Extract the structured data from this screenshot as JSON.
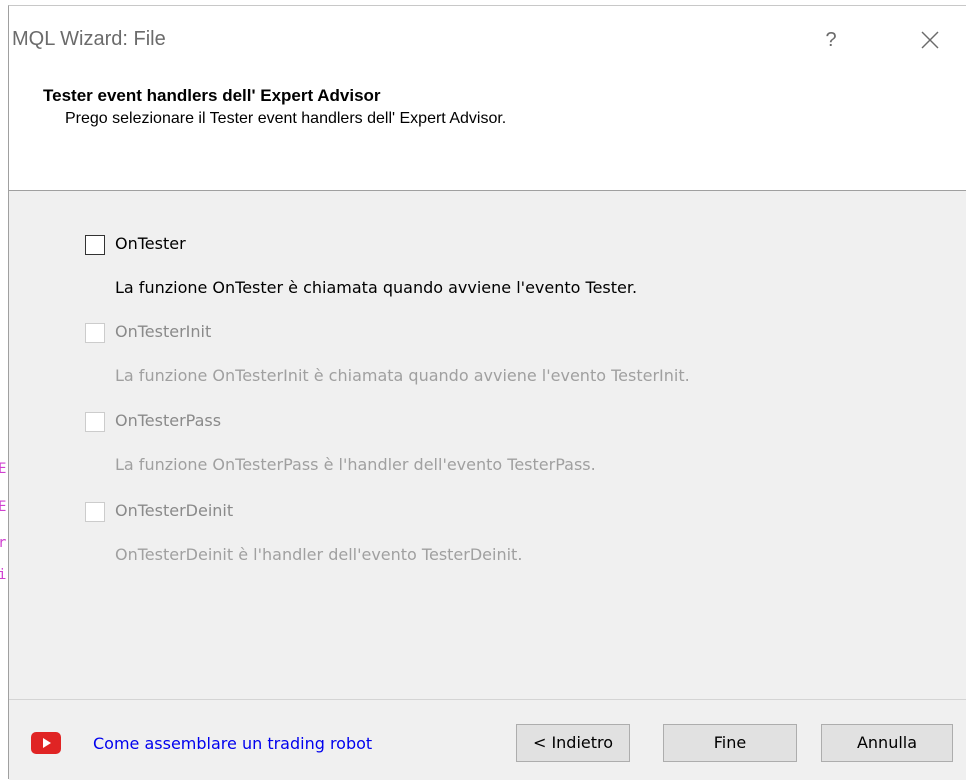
{
  "window": {
    "title": "MQL Wizard: File",
    "help_label": "?",
    "close_icon": "close-icon"
  },
  "header": {
    "title": "Tester event handlers dell' Expert Advisor",
    "subtitle": "Prego selezionare il Tester event handlers dell' Expert Advisor."
  },
  "options": [
    {
      "label": "OnTester",
      "description": "La funzione OnTester è chiamata quando avviene l'evento Tester.",
      "checked": false,
      "enabled": true
    },
    {
      "label": "OnTesterInit",
      "description": "La funzione OnTesterInit è chiamata quando avviene l'evento TesterInit.",
      "checked": false,
      "enabled": false
    },
    {
      "label": "OnTesterPass",
      "description": "La funzione OnTesterPass è l'handler dell'evento TesterPass.",
      "checked": false,
      "enabled": false
    },
    {
      "label": "OnTesterDeinit",
      "description": "OnTesterDeinit è l'handler dell'evento TesterDeinit.",
      "checked": false,
      "enabled": false
    }
  ],
  "footer": {
    "video_icon": "youtube-play-icon",
    "link_text": "Come assemblare un trading robot",
    "back_label": "< Indietro",
    "finish_label": "Fine",
    "cancel_label": "Annulla"
  },
  "colors": {
    "link": "#0000ee",
    "youtube_red": "#e02424",
    "disabled_text": "#a0a0a0",
    "panel_bg": "#f0f0f0"
  }
}
